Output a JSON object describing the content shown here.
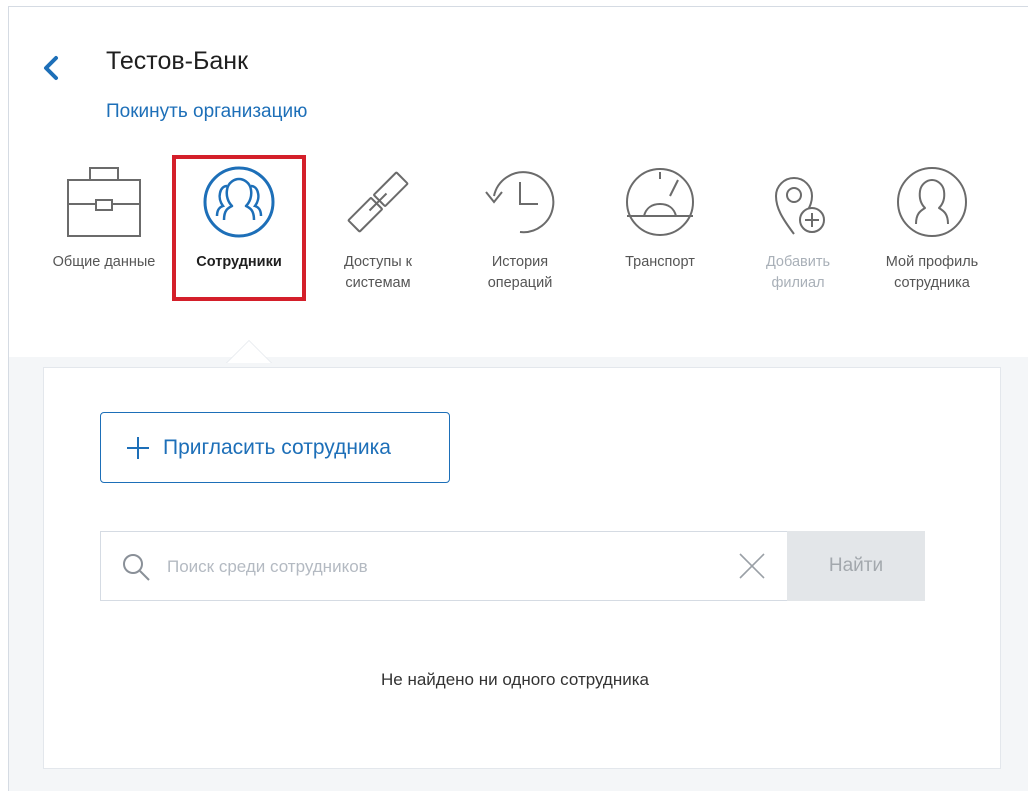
{
  "header": {
    "title": "Тестов-Банк",
    "leave_link": "Покинуть организацию"
  },
  "tabs": [
    {
      "label": "Общие данные",
      "icon": "briefcase-icon",
      "state": "normal"
    },
    {
      "label": "Сотрудники",
      "icon": "employees-icon",
      "state": "active"
    },
    {
      "label": "Доступы к\nсистемам",
      "icon": "link-icon",
      "state": "normal"
    },
    {
      "label": "История\nопераций",
      "icon": "history-icon",
      "state": "normal"
    },
    {
      "label": "Транспорт",
      "icon": "speedometer-icon",
      "state": "normal"
    },
    {
      "label": "Добавить\nфилиал",
      "icon": "add-location-icon",
      "state": "disabled"
    },
    {
      "label": "Мой профиль\nсотрудника",
      "icon": "profile-icon",
      "state": "normal"
    }
  ],
  "panel": {
    "invite_button": "Пригласить сотрудника",
    "search_placeholder": "Поиск среди сотрудников",
    "search_value": "",
    "find_button": "Найти",
    "empty_message": "Не найдено ни одного сотрудника"
  },
  "colors": {
    "accent": "#1d6fb8",
    "highlight": "#d41f2a",
    "icon_gray": "#6b6b6b",
    "disabled": "#a9b0b8"
  }
}
